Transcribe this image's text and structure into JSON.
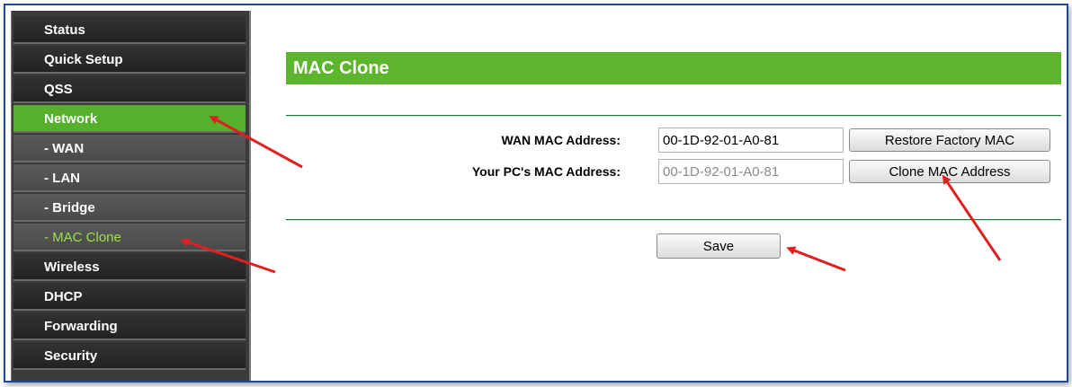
{
  "sidebar": {
    "items": [
      {
        "label": "Status"
      },
      {
        "label": "Quick Setup"
      },
      {
        "label": "QSS"
      },
      {
        "label": "Network"
      },
      {
        "label": "- WAN"
      },
      {
        "label": "- LAN"
      },
      {
        "label": "- Bridge"
      },
      {
        "label": "- MAC Clone"
      },
      {
        "label": "Wireless"
      },
      {
        "label": "DHCP"
      },
      {
        "label": "Forwarding"
      },
      {
        "label": "Security"
      }
    ],
    "active_item": "Network",
    "active_subitem": "- MAC Clone"
  },
  "main": {
    "title": "MAC Clone",
    "wan_mac": {
      "label": "WAN MAC Address:",
      "value": "00-1D-92-01-A0-81",
      "button": "Restore Factory MAC"
    },
    "pc_mac": {
      "label": "Your PC's MAC Address:",
      "value": "00-1D-92-01-A0-81",
      "button": "Clone MAC Address"
    },
    "save_button": "Save"
  },
  "colors": {
    "accent_green": "#5cb52d",
    "sidebar_dark": "#2b2b2b",
    "sub_active_text": "#9de04a",
    "annotation_arrow": "#e02020"
  }
}
